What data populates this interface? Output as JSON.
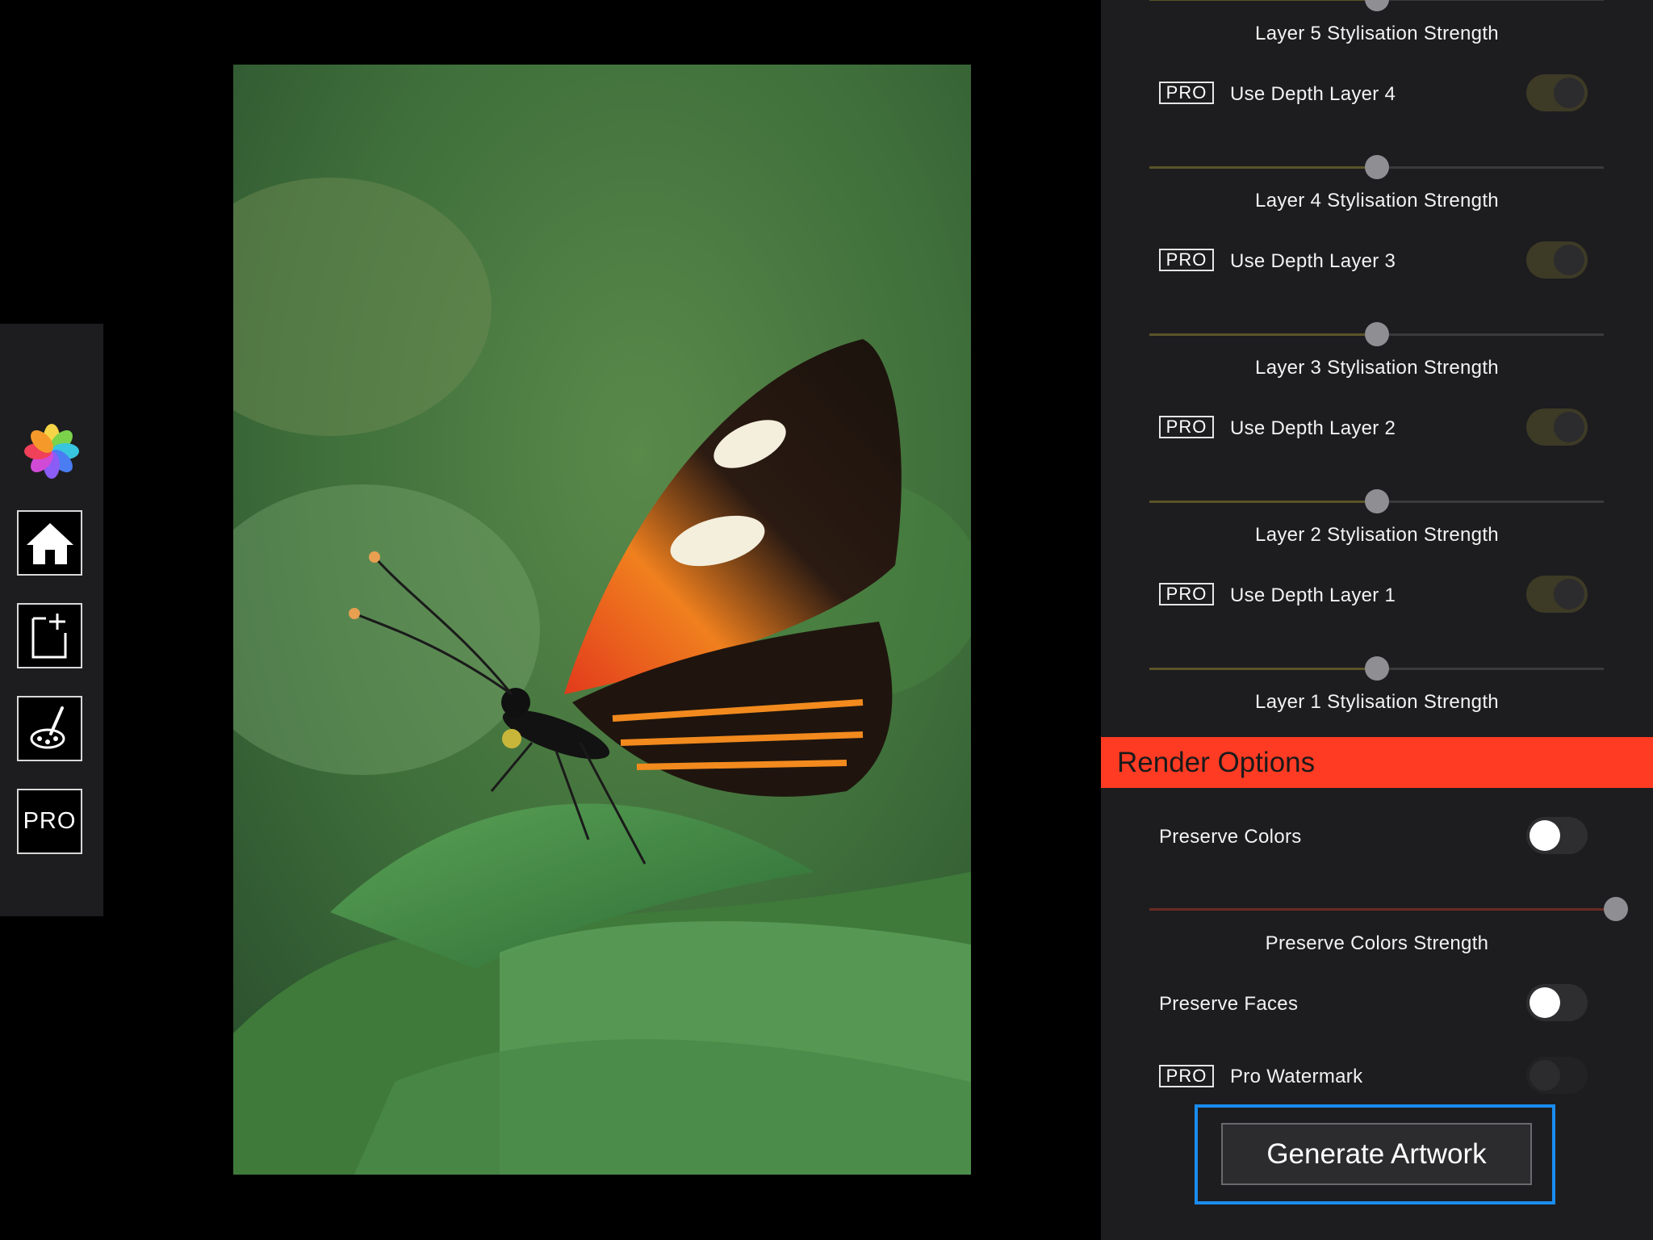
{
  "toolbar": {
    "logo_icon": "pinwheel-logo",
    "home_icon": "home-icon",
    "new_icon": "new-document-icon",
    "style_icon": "paint-palette-icon",
    "pro_label": "PRO"
  },
  "photo": {
    "subject": "butterfly-photo"
  },
  "panel": {
    "pro_badge": "PRO",
    "layers": [
      {
        "label": "Layer 5 Stylisation Strength",
        "value": 0.5
      },
      {
        "toggle": "Use Depth Layer 4",
        "state": "on",
        "label": "Layer 4 Stylisation Strength",
        "value": 0.5
      },
      {
        "toggle": "Use Depth Layer 3",
        "state": "on",
        "label": "Layer 3 Stylisation Strength",
        "value": 0.5
      },
      {
        "toggle": "Use Depth Layer 2",
        "state": "on",
        "label": "Layer 2 Stylisation Strength",
        "value": 0.5
      },
      {
        "toggle": "Use Depth Layer 1",
        "state": "on",
        "label": "Layer 1 Stylisation Strength",
        "value": 0.5
      }
    ],
    "render_options": {
      "title": "Render Options",
      "preserve_colors": "Preserve Colors",
      "preserve_colors_state": "off",
      "preserve_colors_strength": "Preserve Colors Strength",
      "preserve_colors_strength_value": 1.0,
      "preserve_faces": "Preserve Faces",
      "preserve_faces_state": "off",
      "pro_watermark": "Pro Watermark",
      "pro_watermark_state": "disabled"
    },
    "generate_label": "Generate Artwork",
    "colors": {
      "accent_header": "#ff3b24",
      "slider_fill": "#5a5328",
      "preserve_slider_fill": "#6a2a24",
      "focus_outline": "#1a8cf0"
    }
  }
}
